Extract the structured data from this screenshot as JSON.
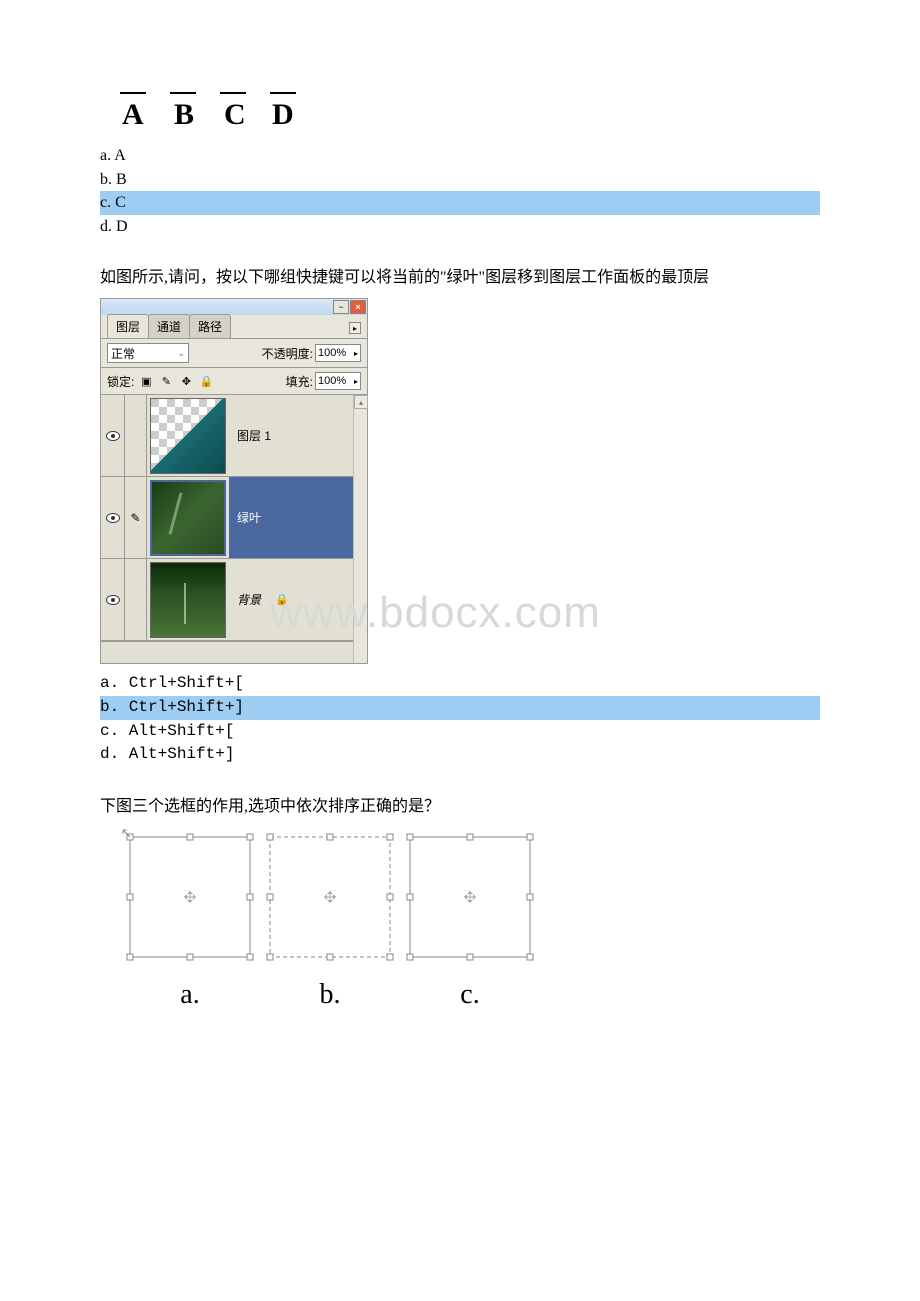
{
  "q1": {
    "image_letters": [
      "A",
      "B",
      "C",
      "D"
    ],
    "options": [
      {
        "label": "a. A",
        "highlighted": false
      },
      {
        "label": "b. B",
        "highlighted": false
      },
      {
        "label": "c. C",
        "highlighted": true
      },
      {
        "label": "d. D",
        "highlighted": false
      }
    ]
  },
  "q2": {
    "question": "如图所示,请问，按以下哪组快捷键可以将当前的\"绿叶\"图层移到图层工作面板的最顶层",
    "panel": {
      "tabs": {
        "layers": "图层",
        "channels": "通道",
        "paths": "路径"
      },
      "blend_mode": "正常",
      "opacity_label": "不透明度:",
      "opacity_value": "100%",
      "lock_label": "锁定:",
      "fill_label": "填充:",
      "fill_value": "100%",
      "layers": [
        {
          "name": "图层 1",
          "selected": false,
          "bg": false
        },
        {
          "name": "绿叶",
          "selected": true,
          "bg": false
        },
        {
          "name": "背景",
          "selected": false,
          "bg": true
        }
      ]
    },
    "options": [
      {
        "label": "a. Ctrl+Shift+[",
        "highlighted": false
      },
      {
        "label": "b. Ctrl+Shift+]",
        "highlighted": true
      },
      {
        "label": "c. Alt+Shift+[",
        "highlighted": false
      },
      {
        "label": "d. Alt+Shift+]",
        "highlighted": false
      }
    ]
  },
  "q3": {
    "question": "下图三个选框的作用,选项中依次排序正确的是？",
    "labels": [
      "a.",
      "b.",
      "c."
    ]
  },
  "watermark": "www.bdocx.com"
}
